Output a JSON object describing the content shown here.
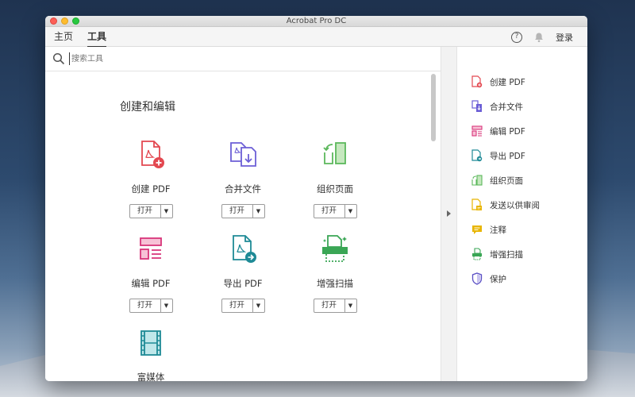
{
  "window": {
    "title": "Acrobat Pro DC"
  },
  "nav": {
    "tab_home": "主页",
    "tab_tools": "工具",
    "help": "?",
    "login": "登录"
  },
  "search": {
    "placeholder": "搜索工具"
  },
  "section": {
    "title": "创建和编辑"
  },
  "tools": [
    {
      "name": "创建 PDF",
      "button": "打开"
    },
    {
      "name": "合并文件",
      "button": "打开"
    },
    {
      "name": "组织页面",
      "button": "打开"
    },
    {
      "name": "编辑 PDF",
      "button": "打开"
    },
    {
      "name": "导出 PDF",
      "button": "打开"
    },
    {
      "name": "增强扫描",
      "button": "打开"
    },
    {
      "name": "富媒体"
    }
  ],
  "sidebar": {
    "items": [
      {
        "label": "创建 PDF",
        "icon": "create-pdf-icon",
        "color": "#e34850"
      },
      {
        "label": "合并文件",
        "icon": "combine-files-icon",
        "color": "#6c5fd6"
      },
      {
        "label": "编辑 PDF",
        "icon": "edit-pdf-icon",
        "color": "#d8357a"
      },
      {
        "label": "导出 PDF",
        "icon": "export-pdf-icon",
        "color": "#1e8a96"
      },
      {
        "label": "组织页面",
        "icon": "organize-pages-icon",
        "color": "#5cb85c"
      },
      {
        "label": "发送以供审阅",
        "icon": "send-review-icon",
        "color": "#e8b500"
      },
      {
        "label": "注释",
        "icon": "comment-icon",
        "color": "#e8b500"
      },
      {
        "label": "增强扫描",
        "icon": "enhance-scan-icon",
        "color": "#3aa655"
      },
      {
        "label": "保护",
        "icon": "protect-icon",
        "color": "#5a4fc4"
      }
    ]
  }
}
